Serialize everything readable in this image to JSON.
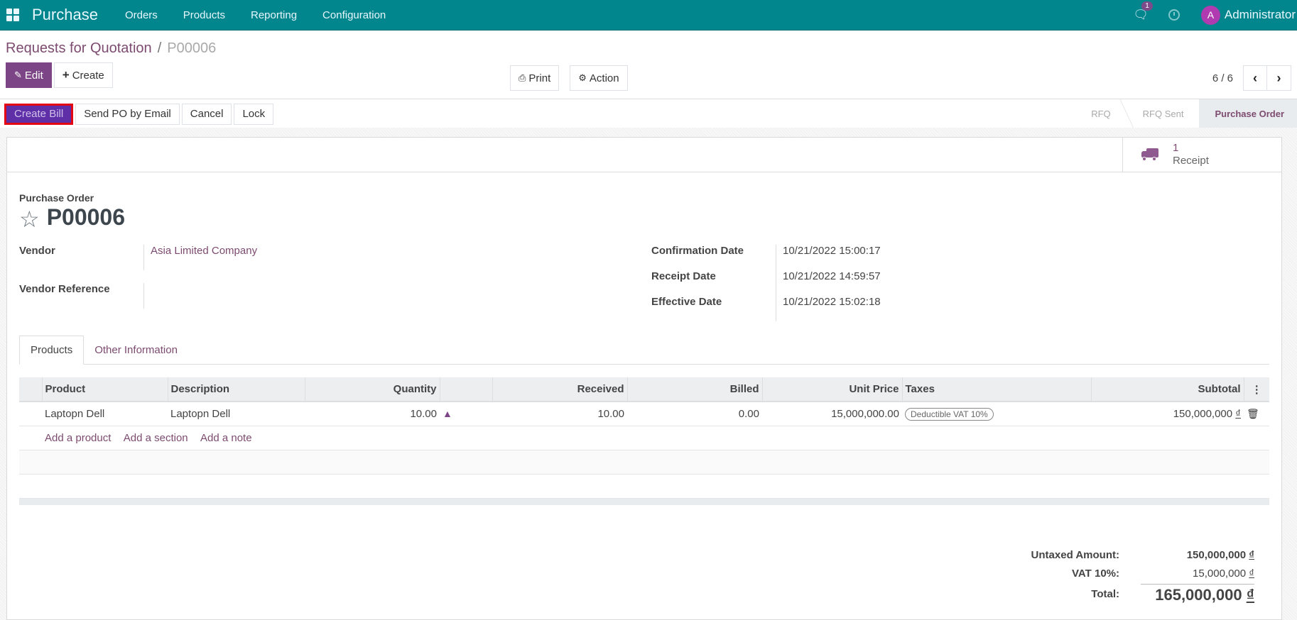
{
  "navbar": {
    "app_name": "Purchase",
    "menu": [
      "Orders",
      "Products",
      "Reporting",
      "Configuration"
    ],
    "chat_badge": "1",
    "avatar_letter": "A",
    "user_name": "Administrator",
    "icons": {
      "apps": "grid-icon",
      "chat": "chat-icon",
      "activity": "clock-icon"
    }
  },
  "breadcrumb": {
    "parent": "Requests for Quotation",
    "separator": "/",
    "current": "P00006"
  },
  "control_panel": {
    "edit_label": "Edit",
    "create_label": "Create",
    "print_label": "Print",
    "action_label": "Action",
    "pager": "6 / 6"
  },
  "statusbar": {
    "buttons": [
      "Create Bill",
      "Send PO by Email",
      "Cancel",
      "Lock"
    ],
    "stages": [
      "RFQ",
      "RFQ Sent",
      "Purchase Order"
    ],
    "active_stage": "Purchase Order"
  },
  "smart_button": {
    "count": "1",
    "label": "Receipt"
  },
  "form": {
    "title_label": "Purchase Order",
    "name": "P00006",
    "left_fields": [
      {
        "label": "Vendor",
        "value": "Asia Limited Company"
      },
      {
        "label": "Vendor Reference",
        "value": ""
      }
    ],
    "right_fields": [
      {
        "label": "Confirmation Date",
        "value": "10/21/2022 15:00:17"
      },
      {
        "label": "Receipt Date",
        "value": "10/21/2022 14:59:57"
      },
      {
        "label": "Effective Date",
        "value": "10/21/2022 15:02:18"
      }
    ]
  },
  "tabs": [
    "Products",
    "Other Information"
  ],
  "lines": {
    "headers": [
      "Product",
      "Description",
      "Quantity",
      "",
      "Received",
      "Billed",
      "Unit Price",
      "Taxes",
      "Subtotal"
    ],
    "rows": [
      {
        "product": "Laptopn Dell",
        "description": "Laptopn Dell",
        "quantity": "10.00",
        "received": "10.00",
        "billed": "0.00",
        "unit_price": "15,000,000.00",
        "tax": "Deductible VAT 10%",
        "subtotal": "150,000,000",
        "currency": "₫"
      }
    ],
    "add_links": [
      "Add a product",
      "Add a section",
      "Add a note"
    ]
  },
  "totals": {
    "untaxed_label": "Untaxed Amount:",
    "untaxed_value": "150,000,000",
    "vat_label": "VAT 10%:",
    "vat_value": "15,000,000",
    "total_label": "Total:",
    "total_value": "165,000,000",
    "currency": "₫"
  },
  "colors": {
    "navbar": "#00868c",
    "primary": "#7c4585",
    "link": "#7c4b6f",
    "highlight_border": "#e30613"
  }
}
